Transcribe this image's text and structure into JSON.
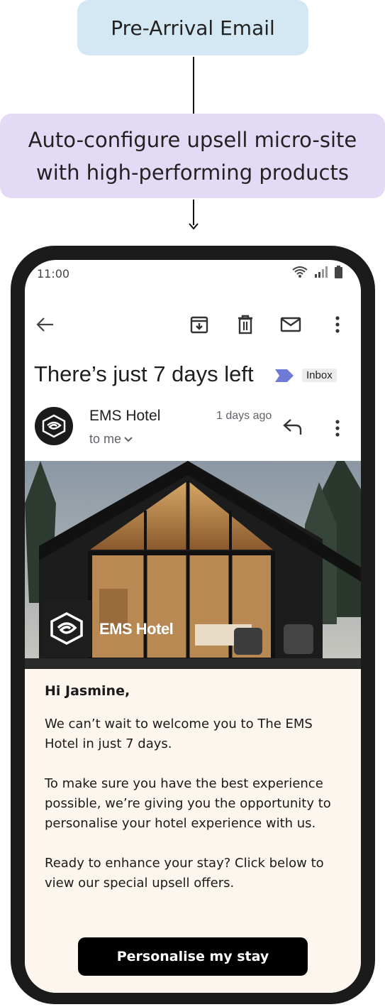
{
  "flow": {
    "step1_label": "Pre-Arrival Email",
    "step2_label": "Auto-configure upsell micro-site with high-performing products"
  },
  "status_bar": {
    "time": "11:00",
    "icons": [
      "wifi-icon",
      "signal-icon",
      "battery-icon"
    ]
  },
  "toolbar": {
    "icons": [
      "back-arrow-icon",
      "archive-icon",
      "delete-icon",
      "mail-icon",
      "more-vert-icon"
    ]
  },
  "email": {
    "subject": "There’s just 7 days left",
    "label": "Inbox",
    "label_color": "#6f79d6",
    "sender": "EMS Hotel",
    "recipient": "to me",
    "time_ago": "1 days ago"
  },
  "hero": {
    "brand": "EMS Hotel"
  },
  "body": {
    "greeting": "Hi Jasmine,",
    "paragraph1": "We can’t wait to welcome you to The EMS Hotel in just 7 days.",
    "paragraph2": "To make sure you have the best experience possible, we’re giving you the opportunity to personalise your hotel experience with us.",
    "paragraph3": "Ready to enhance your stay? Click below to view our special upsell offers.",
    "cta_label": "Personalise my stay"
  },
  "colors": {
    "step1_bg": "#d3e8f3",
    "step2_bg": "#e3dbf6",
    "email_body_bg": "#fdf6ee",
    "phone_frame": "#1b1b1b"
  }
}
